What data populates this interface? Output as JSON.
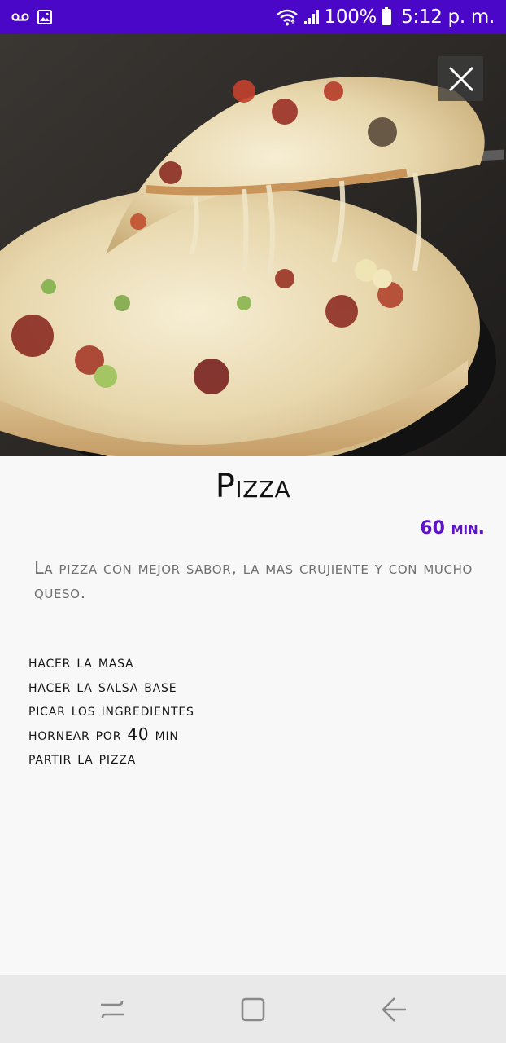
{
  "status_bar": {
    "battery": "100%",
    "time": "5:12 p. m.",
    "left_icons": [
      "voicemail-icon",
      "image-icon"
    ],
    "right_icons": [
      "wifi-icon",
      "signal-icon",
      "battery-icon"
    ],
    "color": "#4a07c7"
  },
  "recipe": {
    "title": "Pizza",
    "time": "60 min.",
    "description": "La pizza con mejor sabor, la mas crujiente y con mucho queso.",
    "steps": [
      "hacer la masa",
      "hacer la salsa base",
      "picar los ingredientes",
      "hornear por 40 min",
      "partir la pizza"
    ],
    "accent_color": "#5c14c8"
  },
  "hero": {
    "image_subject": "pizza-photo",
    "close_icon": "close-icon"
  },
  "nav_bar": {
    "buttons": [
      "recents-icon",
      "home-icon",
      "back-icon"
    ]
  }
}
